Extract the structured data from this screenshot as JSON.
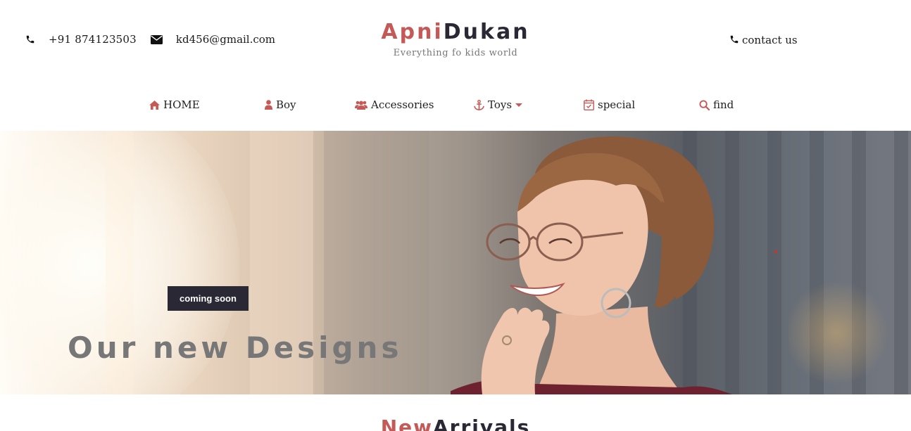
{
  "header": {
    "phone": "+91 874123503",
    "email": "kd456@gmail.com",
    "brand_first": "Apni",
    "brand_second": "Dukan",
    "tagline": "Everything fo kids world",
    "contact_label": "contact us"
  },
  "nav": {
    "items": [
      {
        "label": "HOME",
        "icon": "home-icon"
      },
      {
        "label": "Boy",
        "icon": "user-icon"
      },
      {
        "label": "Accessories",
        "icon": "users-icon"
      },
      {
        "label": "Toys",
        "icon": "anchor-icon",
        "has_dropdown": true
      },
      {
        "label": "special",
        "icon": "calendar-check-icon"
      },
      {
        "label": "find",
        "icon": "search-icon"
      }
    ]
  },
  "hero": {
    "badge": "coming soon",
    "title": "Our new Designs"
  },
  "section": {
    "heading_first": "New",
    "heading_second": "Arrivals"
  },
  "colors": {
    "accent": "#c45a57",
    "dark": "#2b2835",
    "muted": "#777777"
  }
}
